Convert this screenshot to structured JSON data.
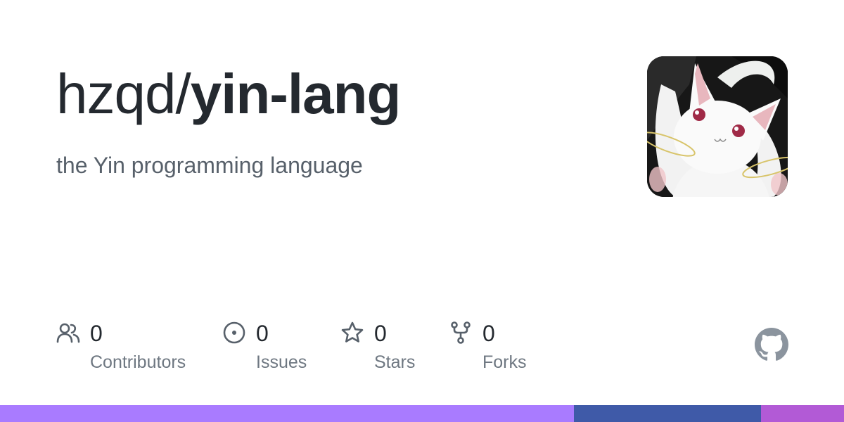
{
  "repo": {
    "owner": "hzqd/",
    "name": "yin-lang",
    "description": "the Yin programming language"
  },
  "avatar": {
    "icon": "white-creature-avatar"
  },
  "stats": [
    {
      "icon": "people-icon",
      "value": "0",
      "label": "Contributors"
    },
    {
      "icon": "issue-circle-icon",
      "value": "0",
      "label": "Issues"
    },
    {
      "icon": "star-icon",
      "value": "0",
      "label": "Stars"
    },
    {
      "icon": "fork-icon",
      "value": "0",
      "label": "Forks"
    }
  ],
  "footer": {
    "logo": "github-logo-icon"
  },
  "languages": [
    {
      "share": 0.68,
      "color": "#a97bff"
    },
    {
      "share": 0.222,
      "color": "#3f5aa8"
    },
    {
      "share": 0.098,
      "color": "#b25ad6"
    }
  ],
  "colors": {
    "text_primary": "#24292f",
    "text_secondary": "#57606a",
    "icon": "#57606a"
  }
}
